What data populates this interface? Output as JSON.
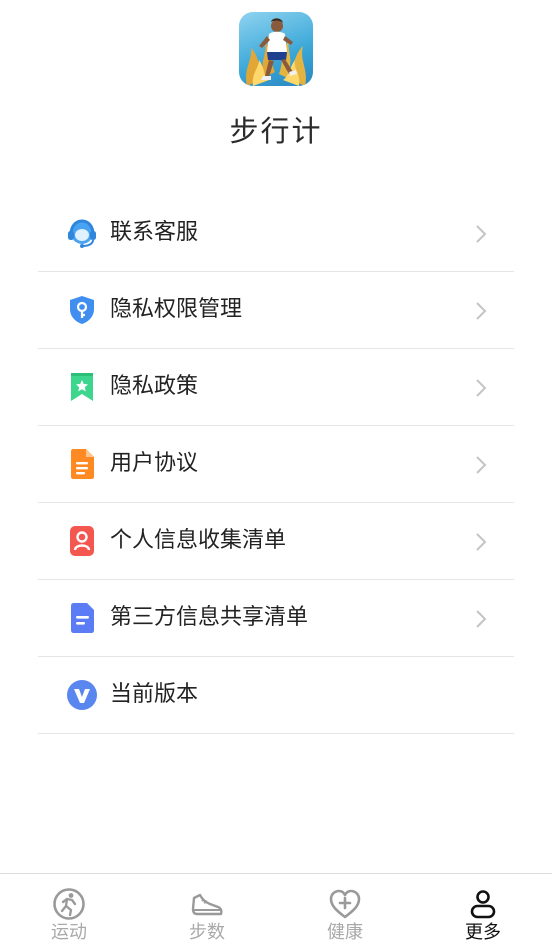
{
  "app": {
    "name": "步行计",
    "logo_icon": "runner-logo"
  },
  "menu": {
    "items": [
      {
        "label": "联系客服",
        "icon": "headset-icon",
        "chevron": true
      },
      {
        "label": "隐私权限管理",
        "icon": "shield-key-icon",
        "chevron": true
      },
      {
        "label": "隐私政策",
        "icon": "bookmark-star-icon",
        "chevron": true
      },
      {
        "label": "用户协议",
        "icon": "document-icon",
        "chevron": true
      },
      {
        "label": "个人信息收集清单",
        "icon": "person-card-icon",
        "chevron": true
      },
      {
        "label": "第三方信息共享清单",
        "icon": "file-lines-icon",
        "chevron": true
      },
      {
        "label": "当前版本",
        "icon": "version-v-icon",
        "chevron": false
      }
    ]
  },
  "tabbar": {
    "tabs": [
      {
        "label": "运动",
        "icon": "running-icon",
        "active": false
      },
      {
        "label": "步数",
        "icon": "shoe-icon",
        "active": false
      },
      {
        "label": "健康",
        "icon": "heart-plus-icon",
        "active": false
      },
      {
        "label": "更多",
        "icon": "person-icon",
        "active": true
      }
    ]
  },
  "colors": {
    "inactive_tab": "#a9a9a9",
    "active_tab": "#111111",
    "divider": "#e6e6e6"
  }
}
